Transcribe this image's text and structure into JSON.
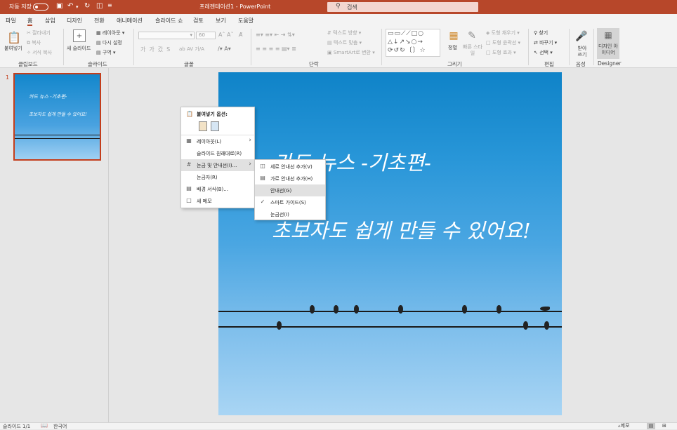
{
  "titlebar": {
    "autosave_label": "자동 저장",
    "doc_title": "프레젠테이션1 - PowerPoint",
    "search_placeholder": "검색"
  },
  "tabs": [
    "파일",
    "홈",
    "삽입",
    "디자인",
    "전환",
    "애니메이션",
    "슬라이드 쇼",
    "검토",
    "보기",
    "도움말"
  ],
  "ribbon": {
    "clipboard": {
      "paste": "붙여넣기",
      "cut": "잘라내기",
      "copy": "복사",
      "format_painter": "서식 복사",
      "group": "클립보드"
    },
    "slides": {
      "new_slide": "새 슬라이드",
      "layout": "레이아웃",
      "reset": "다시 설정",
      "section": "구역",
      "group": "슬라이드"
    },
    "font": {
      "size": "60",
      "group": "글꼴"
    },
    "paragraph": {
      "text_direction": "텍스트 방향",
      "align_text": "텍스트 맞춤",
      "smartart": "SmartArt로 변환",
      "group": "단락"
    },
    "drawing": {
      "arrange": "정렬",
      "quick_styles": "빠른 스타일",
      "fill": "도형 채우기",
      "outline": "도형 윤곽선",
      "effects": "도형 효과",
      "group": "그리기"
    },
    "editing": {
      "find": "찾기",
      "replace": "바꾸기",
      "select": "선택",
      "group": "편집"
    },
    "voice": {
      "dictate": "받아 쓰기",
      "group": "음성"
    },
    "designer": {
      "design_ideas": "디자인 아이디어",
      "group": "Designer"
    }
  },
  "thumbnail": {
    "number": "1",
    "line1": "카드 뉴스 -기초편-",
    "line2": "초보자도 쉽게 만들 수 있어요!"
  },
  "slide": {
    "title": "카드 뉴스 -기초편-",
    "subtitle": "초보자도 쉽게 만들 수 있어요!"
  },
  "context_menu": {
    "paste_options": "붙여넣기 옵션:",
    "items": [
      "레이아웃(L)",
      "슬라이드 원래대로(R)",
      "눈금 및 안내선(I)...",
      "눈금자(R)",
      "배경 서식(B)...",
      "새 메모"
    ]
  },
  "submenu": {
    "items": [
      "세로 안내선 추가(V)",
      "가로 안내선 추가(H)",
      "안내선(G)",
      "스마트 가이드(S)",
      "눈금선(I)"
    ],
    "checked": "스마트 가이드(S)"
  },
  "status": {
    "slide_info": "슬라이드 1/1",
    "language": "한국어",
    "notes": "메모"
  },
  "colors": {
    "accent": "#b7472a",
    "selection": "#c43e1c"
  }
}
